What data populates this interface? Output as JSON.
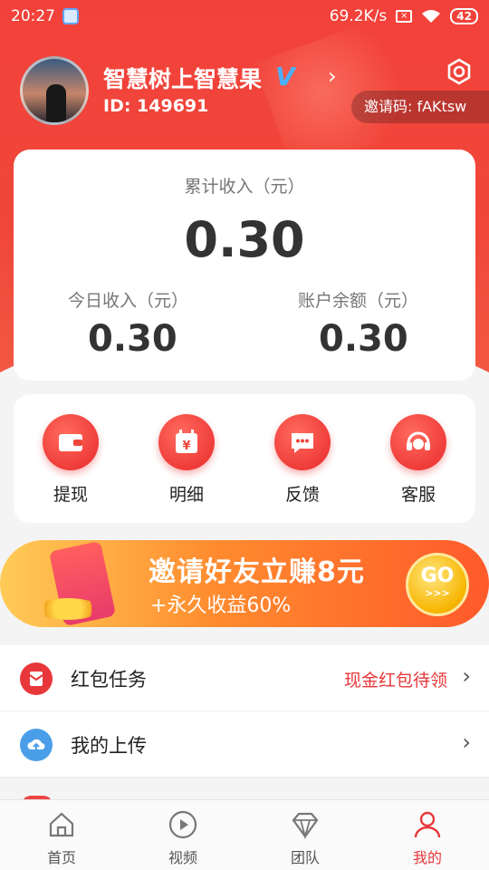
{
  "status_bar": {
    "time": "20:27",
    "speed": "69.2K/s",
    "battery": "42"
  },
  "profile": {
    "nickname": "智慧树上智慧果",
    "verified_badge": "V",
    "user_id": "ID: 149691",
    "invite_code": "邀请码: fAKtsw"
  },
  "income": {
    "total_label": "累计收入（元）",
    "total_value": "0.30",
    "today_label": "今日收入（元）",
    "today_value": "0.30",
    "balance_label": "账户余额（元）",
    "balance_value": "0.30"
  },
  "actions": [
    {
      "label": "提现",
      "icon": "wallet-icon"
    },
    {
      "label": "明细",
      "icon": "calendar-yen-icon"
    },
    {
      "label": "反馈",
      "icon": "chat-bubble-icon"
    },
    {
      "label": "客服",
      "icon": "headset-icon"
    }
  ],
  "banner": {
    "title": "邀请好友立赚8元",
    "subtitle": "+永久收益60%",
    "go_label": "GO",
    "go_arrows": ">>>"
  },
  "list": [
    {
      "label": "红包任务",
      "extra": "现金红包待领",
      "icon": "red-envelope-icon"
    },
    {
      "label": "我的上传",
      "extra": "",
      "icon": "cloud-upload-icon"
    }
  ],
  "tabs": [
    {
      "label": "首页",
      "icon": "home-icon",
      "active": false
    },
    {
      "label": "视频",
      "icon": "play-icon",
      "active": false
    },
    {
      "label": "团队",
      "icon": "diamond-icon",
      "active": false
    },
    {
      "label": "我的",
      "icon": "user-icon",
      "active": true
    }
  ],
  "colors": {
    "brand_red": "#e8373a",
    "header_red": "#f2413a",
    "verified_blue": "#4ab0ff"
  }
}
